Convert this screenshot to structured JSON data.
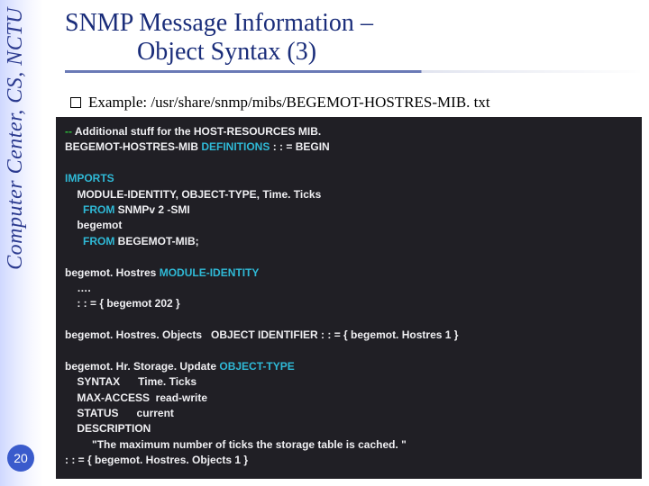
{
  "sidebar": {
    "org_text": "Computer Center, CS, NCTU",
    "page_number": "20"
  },
  "title": {
    "line1_a": "SNMP Message Information ",
    "line1_b": "–",
    "line2": "Object Syntax (3)"
  },
  "example": {
    "label": "Example: /usr/share/snmp/mibs/BEGEMOT-HOSTRES-MIB. txt"
  },
  "code": {
    "l01a": "-- ",
    "l01b": "Additional stuff for the HOST-RESOURCES MIB.",
    "l02a": "BEGEMOT-HOSTRES-MIB ",
    "l02b": "DEFINITIONS ",
    "l02c": ": : = BEGIN",
    "blank1": "",
    "l03": "IMPORTS",
    "l04": "    MODULE-IDENTITY, OBJECT-TYPE, Time. Ticks",
    "l05a": "      FROM ",
    "l05b": "SNMPv 2 -SMI",
    "l06": "    begemot",
    "l07a": "      FROM ",
    "l07b": "BEGEMOT-MIB;",
    "blank2": "",
    "l08a": "begemot. Hostres ",
    "l08b": "MODULE-IDENTITY",
    "l09": "    …. ",
    "l10": "    : : = { begemot 202 }",
    "blank3": "",
    "l11": "begemot. Hostres. Objects   OBJECT IDENTIFIER : : = { begemot. Hostres 1 }",
    "blank4": "",
    "l12a": "begemot. Hr. Storage. Update ",
    "l12b": "OBJECT-TYPE",
    "l13": "    SYNTAX      Time. Ticks",
    "l14": "    MAX-ACCESS  read-write",
    "l15": "    STATUS      current",
    "l16": "    DESCRIPTION",
    "l17": "         \"The maximum number of ticks the storage table is cached. \"",
    "l18": ": : = { begemot. Hostres. Objects 1 }"
  }
}
